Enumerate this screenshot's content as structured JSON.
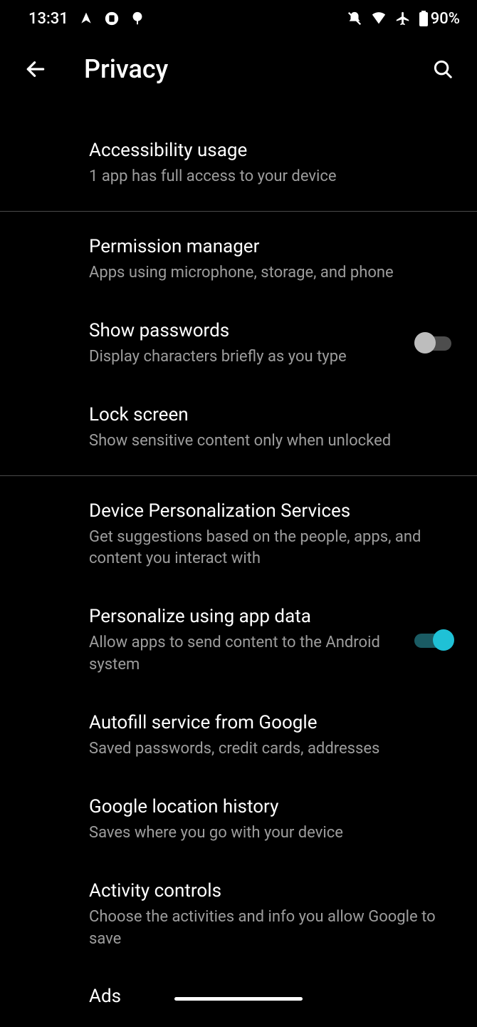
{
  "status": {
    "time": "13:31",
    "battery_pct": "90%"
  },
  "header": {
    "title": "Privacy"
  },
  "items": [
    {
      "title": "Accessibility usage",
      "sub": "1 app has full access to your device"
    },
    {
      "title": "Permission manager",
      "sub": "Apps using microphone, storage, and phone"
    },
    {
      "title": "Show passwords",
      "sub": "Display characters briefly as you type"
    },
    {
      "title": "Lock screen",
      "sub": "Show sensitive content only when unlocked"
    },
    {
      "title": "Device Personalization Services",
      "sub": "Get suggestions based on the people, apps, and content you interact with"
    },
    {
      "title": "Personalize using app data",
      "sub": "Allow apps to send content to the Android system"
    },
    {
      "title": "Autofill service from Google",
      "sub": "Saved passwords, credit cards, addresses"
    },
    {
      "title": "Google location history",
      "sub": "Saves where you go with your device"
    },
    {
      "title": "Activity controls",
      "sub": "Choose the activities and info you allow Google to save"
    },
    {
      "title": "Ads",
      "sub": ""
    }
  ],
  "toggles": {
    "show_passwords": false,
    "personalize_app_data": true
  }
}
